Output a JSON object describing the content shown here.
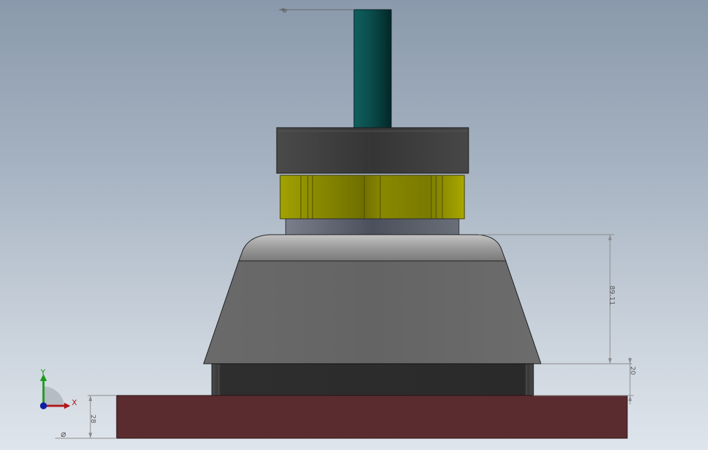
{
  "viewport": {
    "background_top": "#8a99ab",
    "background_bottom": "#dfe5ec"
  },
  "model": {
    "parts": [
      {
        "name": "shaft",
        "color": "#0d4a4a"
      },
      {
        "name": "cap-ring",
        "color": "#3d3d3d"
      },
      {
        "name": "hex-nut",
        "color": "#9a9a00"
      },
      {
        "name": "spacer-collar",
        "color": "#555a66"
      },
      {
        "name": "bell-housing",
        "color": "#686868"
      },
      {
        "name": "lower-band",
        "color": "#2c2c2c"
      },
      {
        "name": "base-plate",
        "color": "#5a2c2f"
      }
    ]
  },
  "dimensions": {
    "housing_height": "89.11",
    "band_height": "20",
    "plate_height": "28",
    "diameter_symbol_bottom": "⌀",
    "diameter_symbol_top": "⌀"
  },
  "triad": {
    "x_label": "X",
    "y_label": "Y",
    "x_color": "#b01818",
    "y_color": "#1a9a1a",
    "z_color": "#1020a0"
  }
}
